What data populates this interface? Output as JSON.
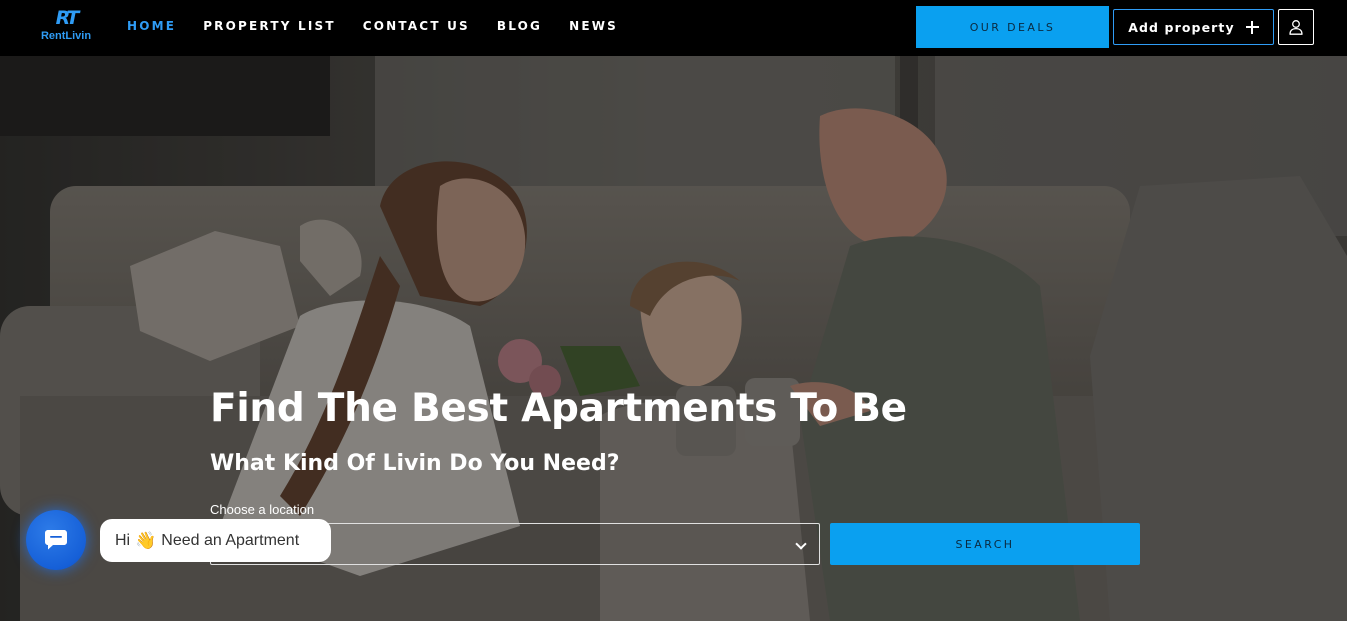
{
  "brand": {
    "logo_mark": "RT",
    "logo_text": "RentLivin",
    "accent_color": "#2f9cf5",
    "button_color": "#0aa0f0"
  },
  "nav": {
    "items": [
      {
        "label": "HOME",
        "active": true
      },
      {
        "label": "PROPERTY LIST",
        "active": false
      },
      {
        "label": "CONTACT US",
        "active": false
      },
      {
        "label": "BLOG",
        "active": false
      },
      {
        "label": "NEWS",
        "active": false
      }
    ]
  },
  "header_actions": {
    "deals_label": "OUR DEALS",
    "add_property_label": "Add property",
    "add_icon": "plus-icon",
    "account_icon": "user-icon"
  },
  "hero": {
    "title": "Find The Best Apartments To Be",
    "subtitle": "What Kind Of Livin Do You Need?",
    "location_label": "Choose a location",
    "location_value": "",
    "search_label": "SEARCH"
  },
  "chat": {
    "launcher_icon": "chat-icon",
    "greeting_before": "Hi",
    "greeting_emoji": "👋",
    "greeting_after": "Need an Apartment"
  }
}
